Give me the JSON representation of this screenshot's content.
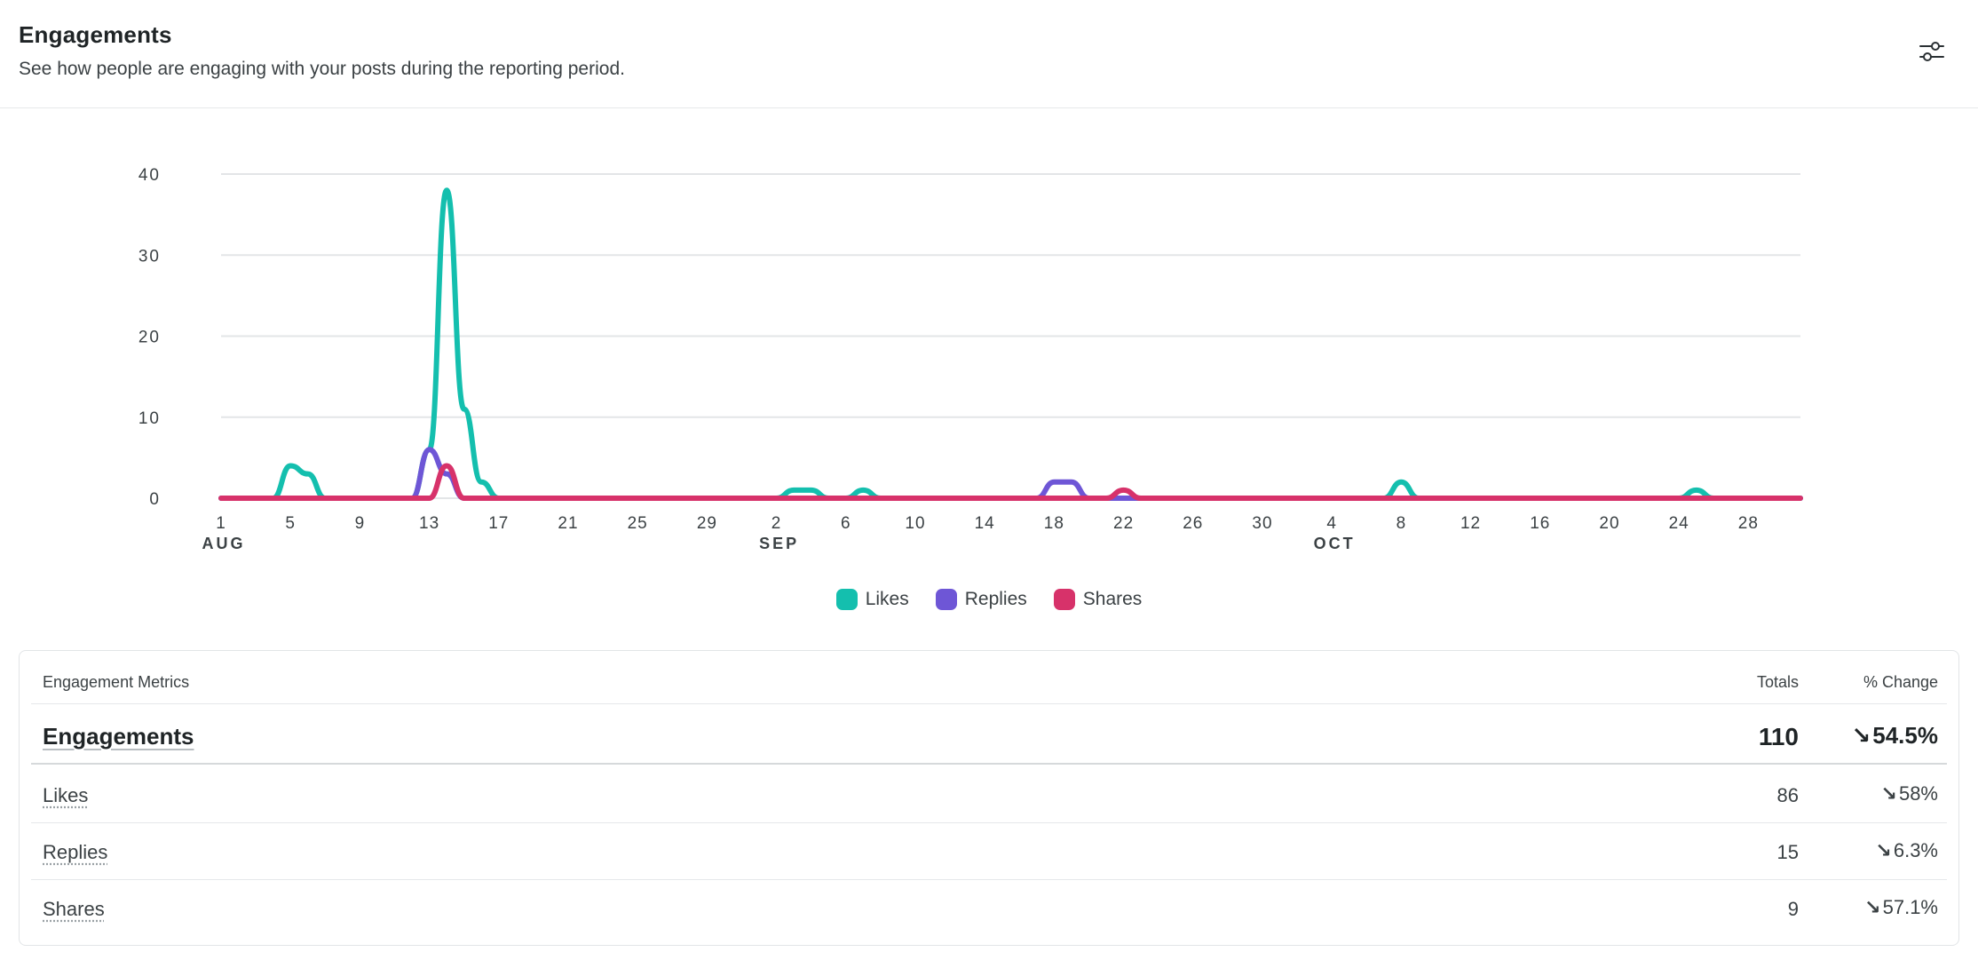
{
  "header": {
    "title": "Engagements",
    "subtitle": "See how people are engaging with your posts during the reporting period.",
    "settings_icon": "sliders-icon"
  },
  "chart_data": {
    "type": "line",
    "title": "",
    "xlabel": "",
    "ylabel": "",
    "ylim": [
      0,
      40
    ],
    "yticks": [
      "0",
      "10",
      "20",
      "30",
      "40"
    ],
    "x_start": "Aug 1",
    "x_count": 92,
    "xticks": [
      {
        "day": 0,
        "label": "1",
        "month": "AUG"
      },
      {
        "day": 4,
        "label": "5"
      },
      {
        "day": 8,
        "label": "9"
      },
      {
        "day": 12,
        "label": "13"
      },
      {
        "day": 16,
        "label": "17"
      },
      {
        "day": 20,
        "label": "21"
      },
      {
        "day": 24,
        "label": "25"
      },
      {
        "day": 28,
        "label": "29"
      },
      {
        "day": 32,
        "label": "2",
        "month": "SEP"
      },
      {
        "day": 36,
        "label": "6"
      },
      {
        "day": 40,
        "label": "10"
      },
      {
        "day": 44,
        "label": "14"
      },
      {
        "day": 48,
        "label": "18"
      },
      {
        "day": 52,
        "label": "22"
      },
      {
        "day": 56,
        "label": "26"
      },
      {
        "day": 60,
        "label": "30"
      },
      {
        "day": 64,
        "label": "4",
        "month": "OCT"
      },
      {
        "day": 68,
        "label": "8"
      },
      {
        "day": 72,
        "label": "12"
      },
      {
        "day": 76,
        "label": "16"
      },
      {
        "day": 80,
        "label": "20"
      },
      {
        "day": 84,
        "label": "24"
      },
      {
        "day": 88,
        "label": "28"
      }
    ],
    "grid": true,
    "legend_position": "bottom-center",
    "series": [
      {
        "name": "Likes",
        "color": "#14bfae",
        "points": [
          [
            4,
            4
          ],
          [
            5,
            3
          ],
          [
            12,
            6
          ],
          [
            13,
            38
          ],
          [
            14,
            11
          ],
          [
            15,
            2
          ],
          [
            33,
            1
          ],
          [
            34,
            1
          ],
          [
            37,
            1
          ],
          [
            68,
            2
          ],
          [
            85,
            1
          ]
        ]
      },
      {
        "name": "Replies",
        "color": "#6e56d6",
        "points": [
          [
            12,
            6
          ],
          [
            13,
            3
          ],
          [
            48,
            2
          ],
          [
            49,
            2
          ]
        ]
      },
      {
        "name": "Shares",
        "color": "#d7326a",
        "points": [
          [
            13,
            4
          ],
          [
            52,
            1
          ]
        ]
      }
    ]
  },
  "legend": [
    {
      "label": "Likes",
      "color": "#14bfae"
    },
    {
      "label": "Replies",
      "color": "#6e56d6"
    },
    {
      "label": "Shares",
      "color": "#d7326a"
    }
  ],
  "table": {
    "col_metric": "Engagement Metrics",
    "col_totals": "Totals",
    "col_change": "% Change",
    "main": {
      "label": "Engagements",
      "total": "110",
      "arrow": "↘",
      "change": "54.5%"
    },
    "rows": [
      {
        "label": "Likes",
        "total": "86",
        "arrow": "↘",
        "change": "58%"
      },
      {
        "label": "Replies",
        "total": "15",
        "arrow": "↘",
        "change": "6.3%"
      },
      {
        "label": "Shares",
        "total": "9",
        "arrow": "↘",
        "change": "57.1%"
      }
    ]
  }
}
